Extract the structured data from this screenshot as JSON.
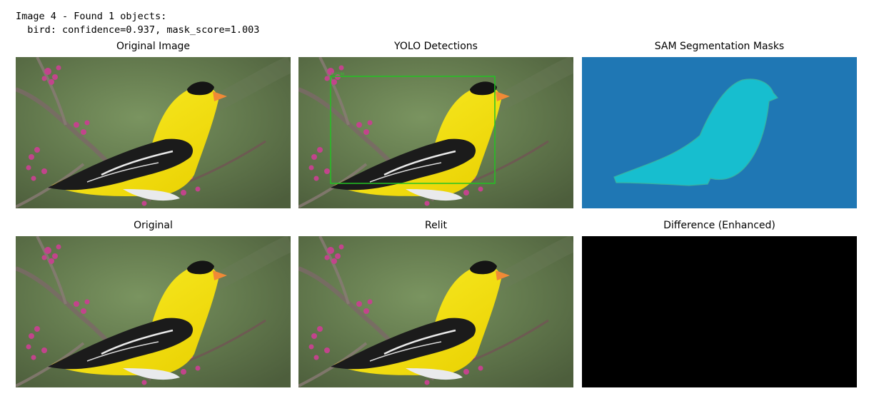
{
  "output": {
    "line1": "Image 4 - Found 1 objects:",
    "line2": "  bird: confidence=0.937, mask_score=1.003"
  },
  "panels": [
    {
      "title": "Original Image"
    },
    {
      "title": "YOLO Detections"
    },
    {
      "title": "SAM Segmentation Masks"
    },
    {
      "title": "Original"
    },
    {
      "title": "Relit"
    },
    {
      "title": "Difference (Enhanced)"
    }
  ],
  "detection": {
    "label": "bird 0.94",
    "box_color": "#22c322"
  },
  "colors": {
    "mask_background": "#1f77b4",
    "mask_object": "#17becf",
    "difference_background": "#000000",
    "bird_yellow": "#f2e20a",
    "background_green": "#6f8a55"
  }
}
